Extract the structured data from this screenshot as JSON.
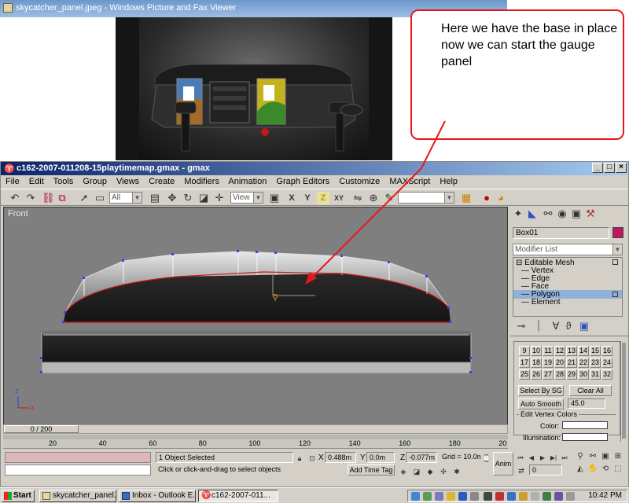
{
  "viewer": {
    "title": "skycatcher_panel.jpeg - Windows Picture and Fax Viewer"
  },
  "callout": {
    "text": "Here we have the base in place now we can start the gauge panel"
  },
  "gmax": {
    "title": "c162-2007-011208-15playtimemap.gmax - gmax",
    "window_buttons": [
      "_",
      "□",
      "×"
    ],
    "menu": [
      "File",
      "Edit",
      "Tools",
      "Group",
      "Views",
      "Create",
      "Modifiers",
      "Animation",
      "Graph Editors",
      "Customize",
      "MAXScript",
      "Help"
    ],
    "toolbar": {
      "selection_filter": "All",
      "reference_coord": "View",
      "constraint_x": "X",
      "constraint_y": "Y",
      "constraint_z": "Z",
      "constraint_xy": "XY"
    },
    "viewport": {
      "label": "Front",
      "axis_x": "x",
      "axis_z": "z"
    },
    "command_panel": {
      "object_name": "Box01",
      "object_color": "#c0185a",
      "modifier_list": "Modifier List",
      "stack": [
        "Editable Mesh",
        "Vertex",
        "Edge",
        "Face",
        "Polygon",
        "Element"
      ],
      "selected_stack_item": "Polygon",
      "smoothing_groups": [
        "9",
        "10",
        "11",
        "12",
        "13",
        "14",
        "15",
        "16",
        "17",
        "18",
        "19",
        "20",
        "21",
        "22",
        "23",
        "24",
        "25",
        "26",
        "27",
        "28",
        "29",
        "30",
        "31",
        "32"
      ],
      "select_by_sg": "Select By SG",
      "clear_all": "Clear All",
      "auto_smooth": "Auto Smooth",
      "auto_smooth_value": "45.0",
      "vertex_colors_group": "Edit Vertex Colors",
      "color_label": "Color:",
      "illumination_label": "Illumination:"
    },
    "time": {
      "frame": "0 / 200",
      "ruler": [
        "20",
        "40",
        "60",
        "80",
        "100",
        "120",
        "140",
        "160",
        "180",
        "20"
      ]
    },
    "status": {
      "selection": "1 Object Selected",
      "prompt": "Click or click-and-drag to select objects",
      "x_label": "X",
      "x_value": "0.488m",
      "y_label": "Y",
      "y_value": "0.0m",
      "z_label": "Z",
      "z_value": "-0.077m",
      "grid": "Grid = 10.0m",
      "add_time_tag": "Add Time Tag",
      "anim": "Anim",
      "frame_field": "0"
    }
  },
  "taskbar": {
    "start": "Start",
    "tasks": [
      "skycatcher_panel.jp...",
      "Inbox - Outlook E...",
      "c162-2007-011..."
    ],
    "clock": "10:42 PM"
  }
}
